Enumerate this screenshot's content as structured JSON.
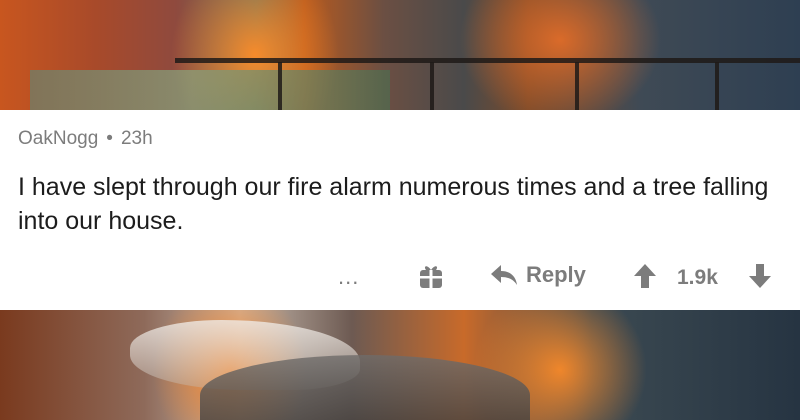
{
  "comment": {
    "username": "OakNogg",
    "separator": "•",
    "timestamp": "23h",
    "body": "I have slept through our fire alarm numerous times and a tree falling into our house."
  },
  "actions": {
    "more_label": "...",
    "reply_label": "Reply",
    "score": "1.9k"
  },
  "icons": {
    "more": "more-options-icon",
    "gift": "gift-icon",
    "reply": "reply-arrow-icon",
    "upvote": "upvote-arrow-icon",
    "downvote": "downvote-arrow-icon"
  },
  "colors": {
    "card_background": "#ffffff",
    "meta_text": "#7c7c7c",
    "body_text": "#1c1c1c"
  }
}
